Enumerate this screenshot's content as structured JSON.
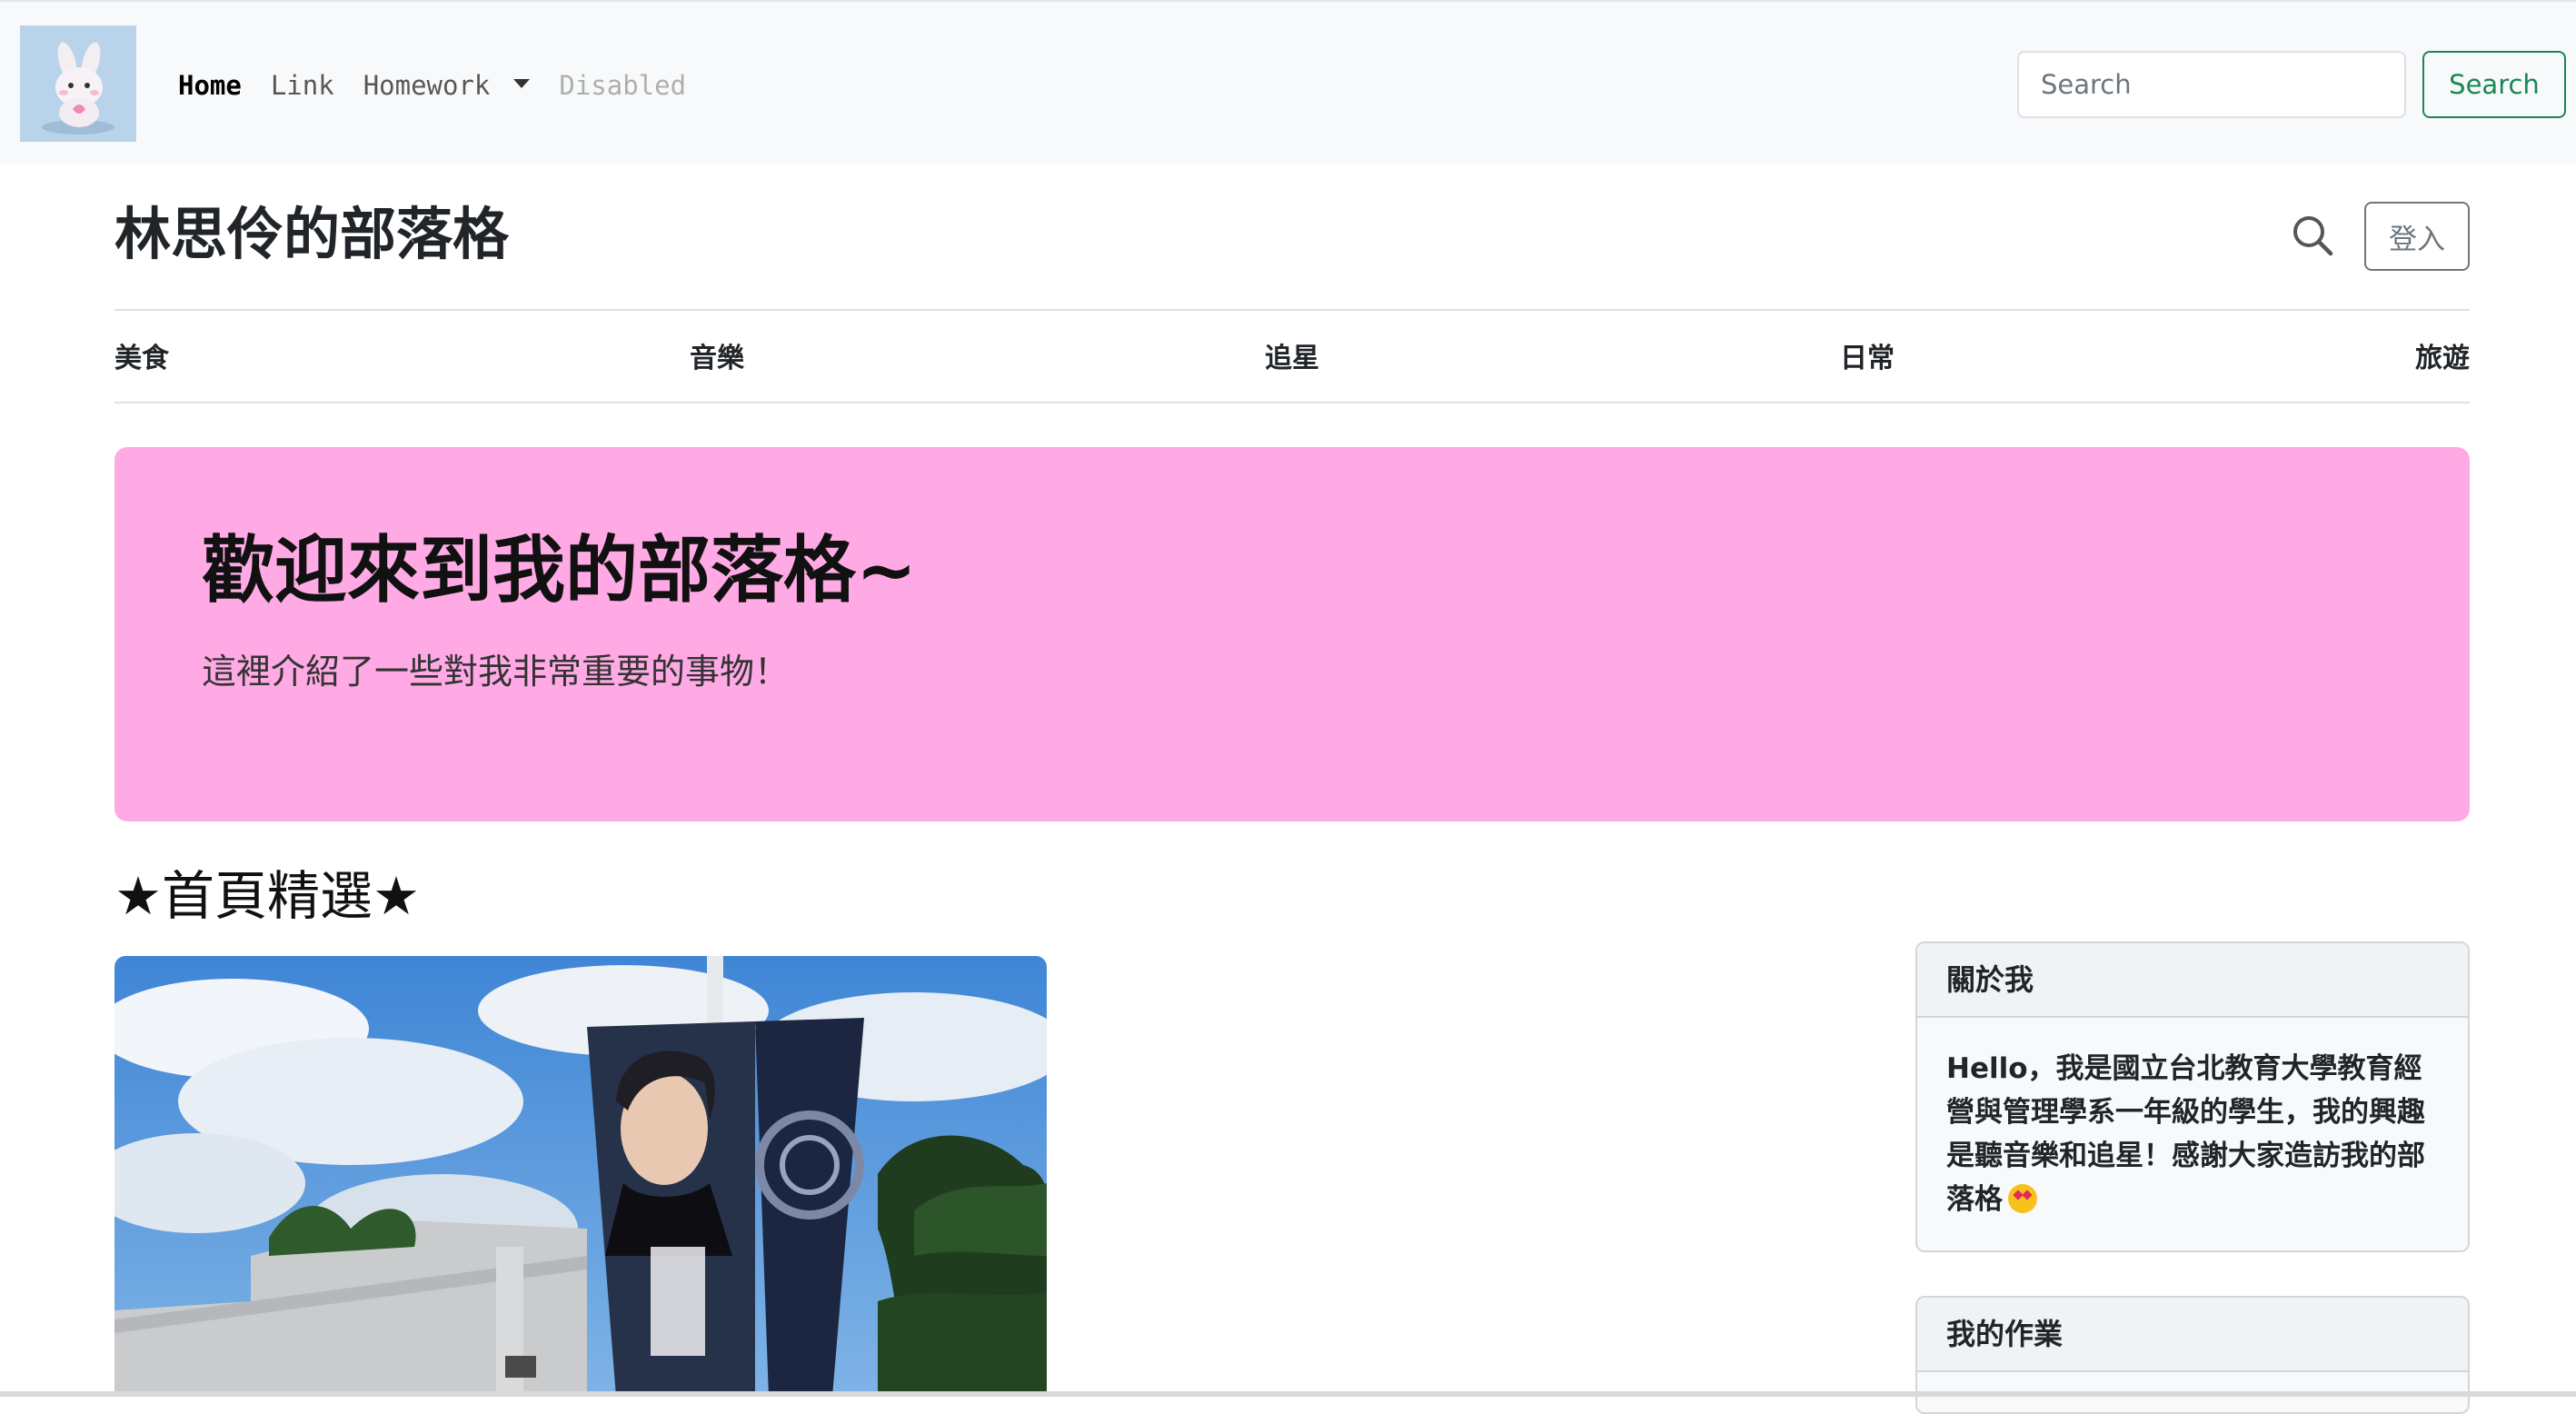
{
  "navbar": {
    "brand_alt": "logo",
    "links": [
      {
        "label": "Home"
      },
      {
        "label": "Link"
      },
      {
        "label": "Homework"
      },
      {
        "label": "Disabled"
      }
    ],
    "search_placeholder": "Search",
    "search_button": "Search"
  },
  "blog": {
    "title": "林思伶的部落格",
    "login_button": "登入",
    "categories": [
      "美食",
      "音樂",
      "追星",
      "日常",
      "旅遊"
    ]
  },
  "jumbotron": {
    "title": "歡迎來到我的部落格~",
    "lead": "這裡介紹了一些對我非常重要的事物！",
    "background": "#ffaae5"
  },
  "featured": {
    "heading": "★首頁精選★"
  },
  "sidebar": {
    "about": {
      "header": "關於我",
      "lines": [
        "Hello，我是國立台北教育大學教育經",
        "營與管理學系一年級的學生，我的興趣",
        "是聽音樂和追星！感謝大家造訪我的部",
        "落格"
      ]
    },
    "homework": {
      "header": "我的作業"
    }
  },
  "colors": {
    "accent_green": "#198754",
    "navbar_bg": "#f8f9fa"
  }
}
